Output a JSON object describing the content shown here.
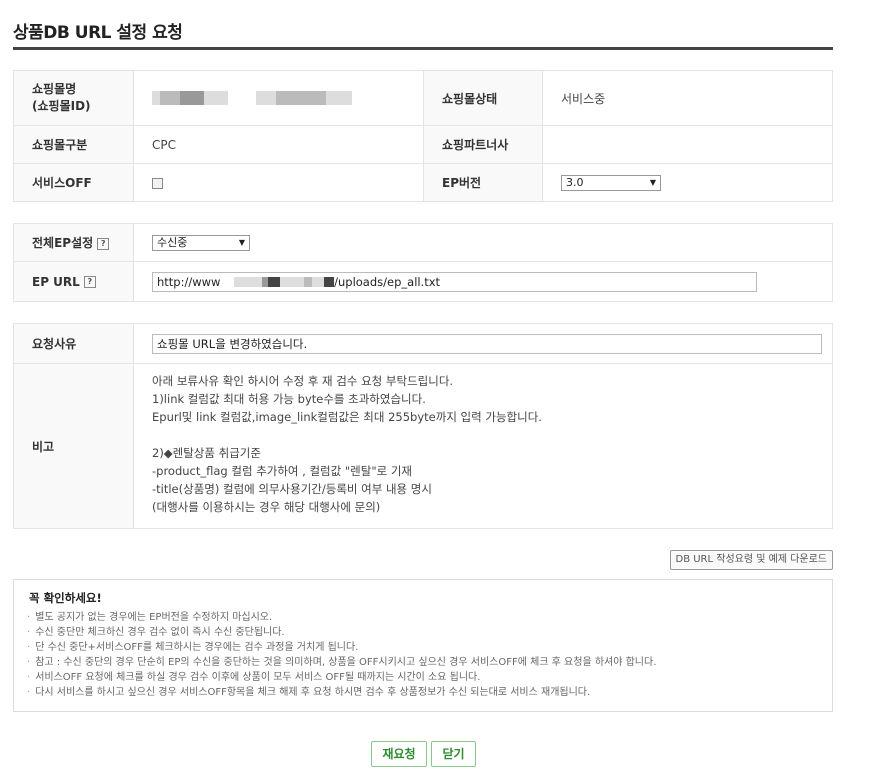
{
  "page": {
    "title": "상품DB URL 설정 요청"
  },
  "info_table": {
    "mall_name_label": "쇼핑몰명\n(쇼핑몰ID)",
    "mall_status_label": "쇼핑몰상태",
    "mall_status_value": "서비스중",
    "mall_type_label": "쇼핑몰구분",
    "mall_type_value": "CPC",
    "partner_label": "쇼핑파트너사",
    "partner_value": "",
    "service_off_label": "서비스OFF",
    "ep_version_label": "EP버전",
    "ep_version_value": "3.0"
  },
  "ep_table": {
    "all_ep_label": "전체EP설정",
    "all_ep_value": "수신중",
    "ep_url_label": "EP URL",
    "ep_url_prefix": "http://www",
    "ep_url_suffix": "/uploads/ep_all.txt"
  },
  "request_table": {
    "reason_label": "요청사유",
    "reason_value": "쇼핑몰 URL을 변경하였습니다.",
    "note_label": "비고",
    "note_lines": [
      "아래 보류사유 확인 하시어 수정 후 재 검수 요청 부탁드립니다.",
      "1)link 컬럼값 최대 허용 가능 byte수를 초과하였습니다.",
      "Epurl및 link 컬럼값,image_link컬럼값은 최대 255byte까지 입력 가능합니다.",
      "",
      "2)◆렌탈상품 취급기준",
      "-product_flag 컬럼 추가하여 , 컬럼값 \"렌탈\"로 기재",
      "-title(상품명) 컬럼에 의무사용기간/등록비 여부 내용 명시",
      "(대행사를 이용하시는 경우 해당 대행사에 문의)"
    ]
  },
  "download_button": "DB URL 작성요령 및 예제 다운로드",
  "notice": {
    "heading": "꼭 확인하세요!",
    "items": [
      "별도 공지가 없는 경우에는 EP버전을 수정하지 마십시오.",
      "수신 중단만 체크하신 경우 검수 없이 즉시 수신 중단됩니다.",
      "단 수신 중단+서비스OFF를 체크하시는 경우에는 검수 과정을 거치게 됩니다.",
      "참고 : 수신 중단의 경우 단순히 EP의 수신을 중단하는 것을 의미하며, 상품을 OFF시키시고 싶으신 경우 서비스OFF에 체크 후 요청을 하셔야 합니다.",
      "서비스OFF 요청에 체크를 하실 경우 검수 이후에 상품이 모두 서비스 OFF될 때까지는 시간이 소요 됩니다.",
      "다시 서비스를 하시고 싶으신 경우 서비스OFF항목을 체크 해제 후 요청 하시면 검수 후 상품정보가 수신 되는대로 서비스 재개됩니다."
    ]
  },
  "buttons": {
    "resubmit": "재요청",
    "close": "닫기"
  },
  "colors": {
    "button_border": "#8ec58e",
    "button_text": "#2e8b2e",
    "header_bg": "#f9f9f9"
  }
}
